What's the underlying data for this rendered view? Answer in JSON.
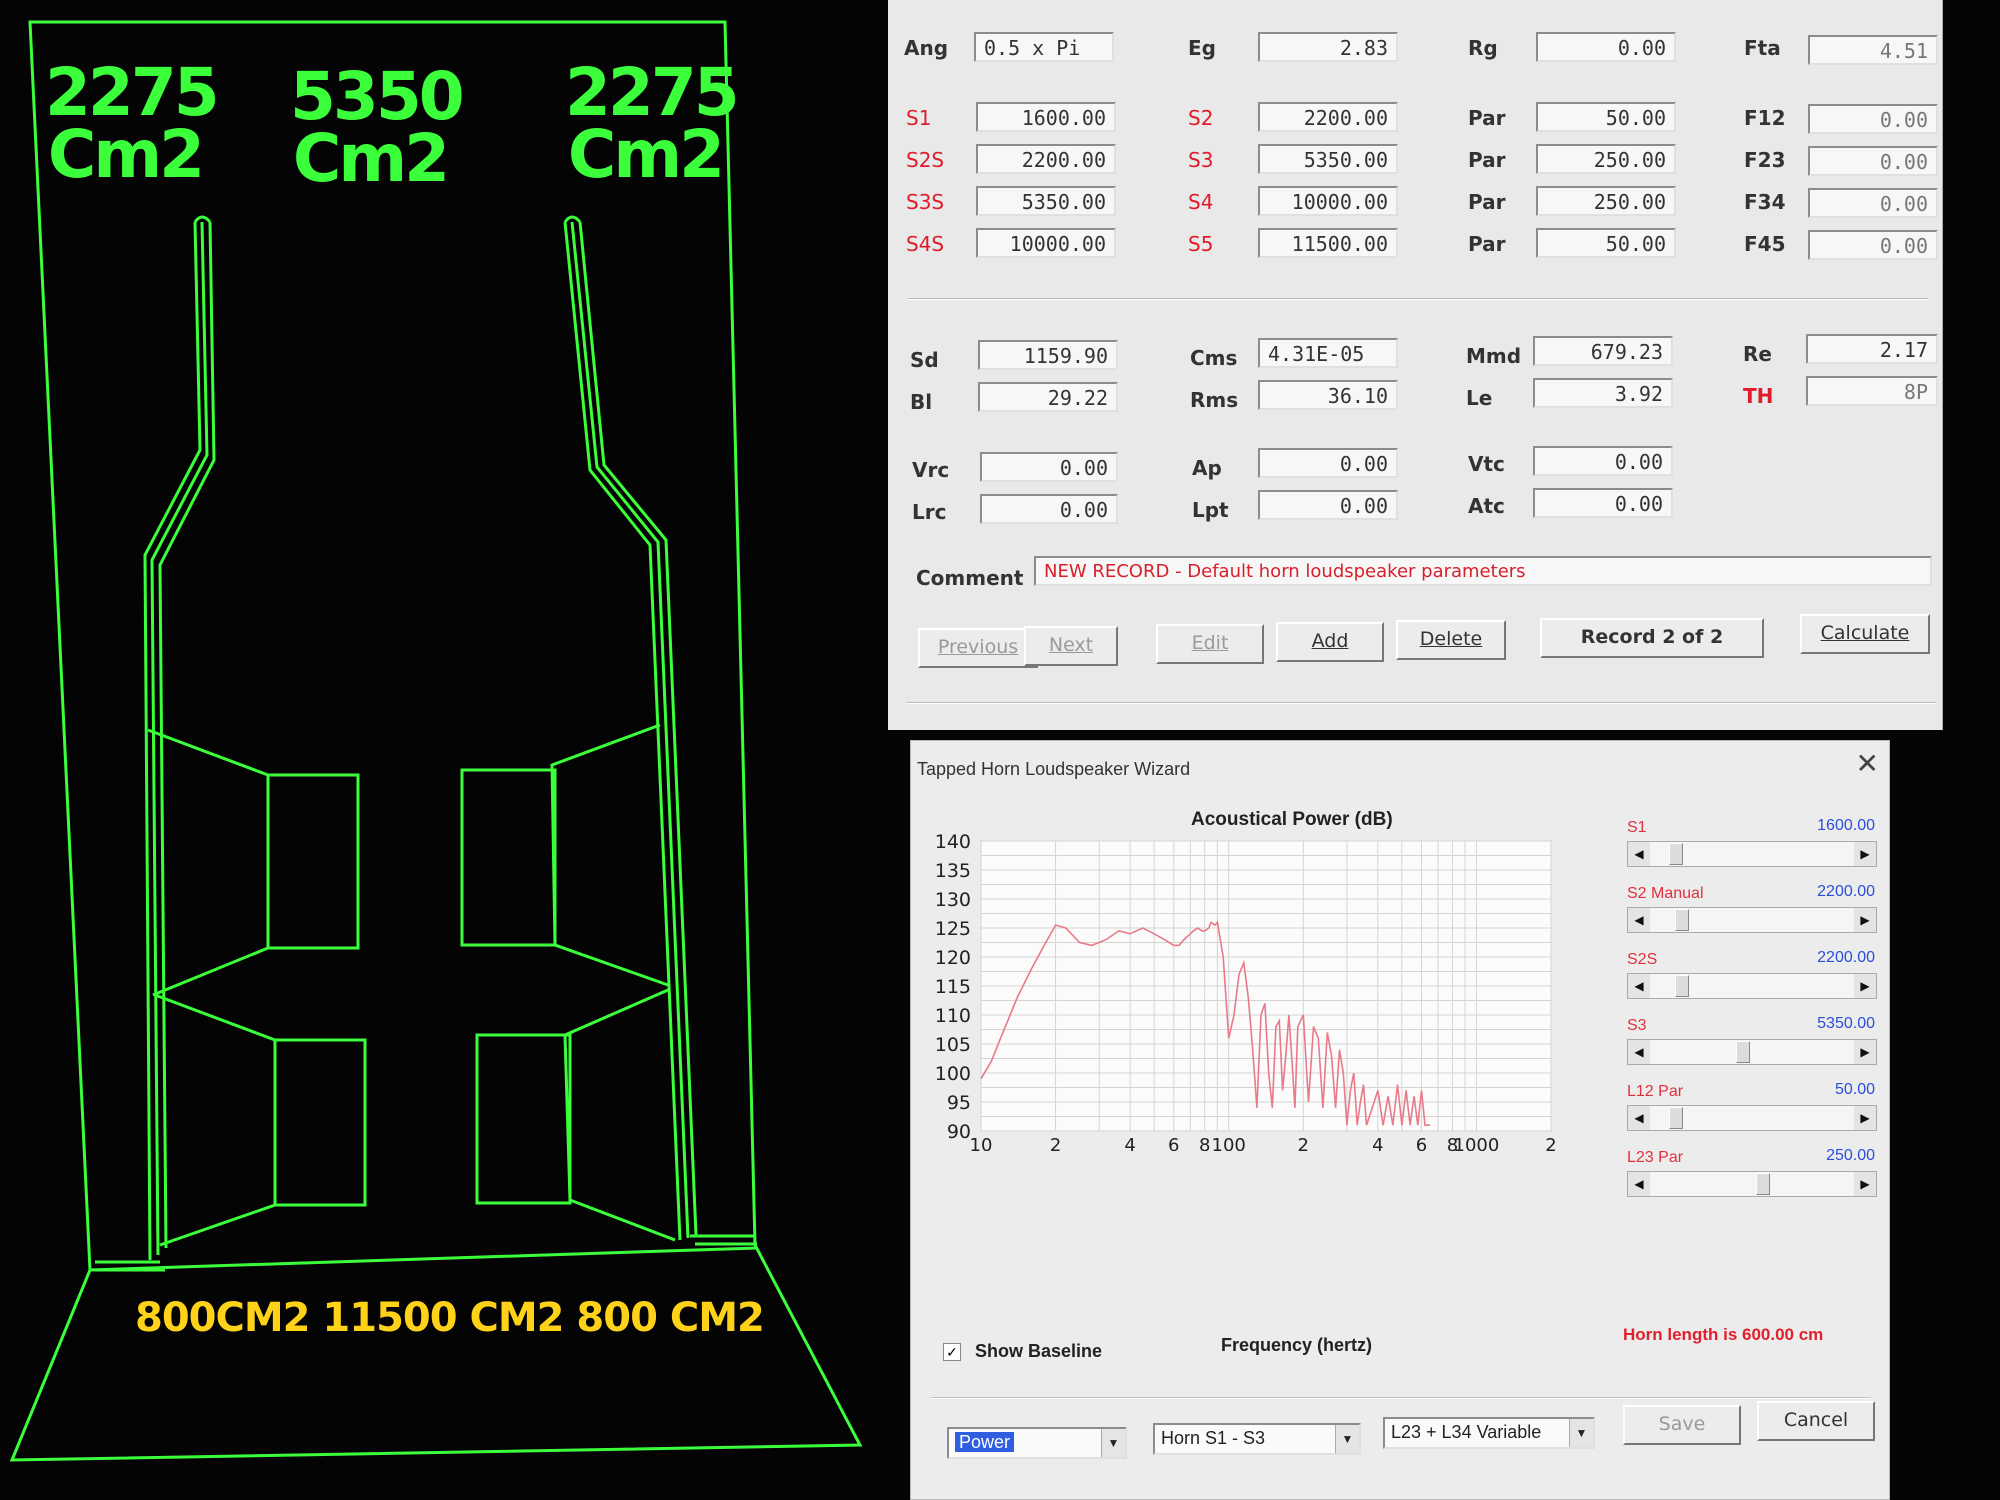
{
  "drawing": {
    "labels_top": [
      {
        "line1": "2275",
        "line2": "Cm2"
      },
      {
        "line1": "5350",
        "line2": "Cm2"
      },
      {
        "line1": "2275",
        "line2": "Cm2"
      }
    ],
    "bottom_label": "800CM2 11500 CM2 800 CM2",
    "line_color": "#3bff3b",
    "text_color_bottom": "#ffd21a"
  },
  "params": {
    "row_top": [
      {
        "label": "Ang",
        "value": "0.5 x Pi"
      },
      {
        "label": "Eg",
        "value": "2.83"
      },
      {
        "label": "Rg",
        "value": "0.00"
      },
      {
        "label": "Fta",
        "value": "4.51"
      }
    ],
    "section_rows": [
      {
        "s": "S1",
        "sv": "1600.00",
        "s2": "S2",
        "s2v": "2200.00",
        "par": "Par",
        "parv": "50.00",
        "f": "F12",
        "fv": "0.00"
      },
      {
        "s": "S2S",
        "sv": "2200.00",
        "s2": "S3",
        "s2v": "5350.00",
        "par": "Par",
        "parv": "250.00",
        "f": "F23",
        "fv": "0.00"
      },
      {
        "s": "S3S",
        "sv": "5350.00",
        "s2": "S4",
        "s2v": "10000.00",
        "par": "Par",
        "parv": "250.00",
        "f": "F34",
        "fv": "0.00"
      },
      {
        "s": "S4S",
        "sv": "10000.00",
        "s2": "S5",
        "s2v": "11500.00",
        "par": "Par",
        "parv": "50.00",
        "f": "F45",
        "fv": "0.00"
      }
    ],
    "driver_rows": [
      {
        "a": "Sd",
        "av": "1159.90",
        "b": "Cms",
        "bv": "4.31E-05",
        "c": "Mmd",
        "cv": "679.23",
        "d": "Re",
        "dv": "2.17"
      },
      {
        "a": "Bl",
        "av": "29.22",
        "b": "Rms",
        "bv": "36.10",
        "c": "Le",
        "cv": "3.92",
        "d": "TH",
        "dv": "8P"
      }
    ],
    "volume_rows": [
      {
        "a": "Vrc",
        "av": "0.00",
        "b": "Ap",
        "bv": "0.00",
        "c": "Vtc",
        "cv": "0.00"
      },
      {
        "a": "Lrc",
        "av": "0.00",
        "b": "Lpt",
        "bv": "0.00",
        "c": "Atc",
        "cv": "0.00"
      }
    ],
    "comment_label": "Comment",
    "comment_value": "NEW RECORD - Default horn loudspeaker parameters",
    "buttons": {
      "previous": "Previous",
      "next": "Next",
      "edit": "Edit",
      "add": "Add",
      "delete": "Delete",
      "record": "Record 2 of 2",
      "calculate": "Calculate"
    }
  },
  "wizard": {
    "title": "Tapped Horn Loudspeaker Wizard",
    "close": "✕",
    "chart_title": "Acoustical Power (dB)",
    "x_axis_label": "Frequency (hertz)",
    "x_tick_labels": [
      "10",
      "2",
      "4",
      "6",
      "8",
      "100",
      "2",
      "4",
      "6",
      "8",
      "1000",
      "2"
    ],
    "y_tick_labels": [
      "140",
      "135",
      "130",
      "125",
      "120",
      "115",
      "110",
      "105",
      "100",
      "95",
      "90"
    ],
    "show_baseline": {
      "checked": true,
      "label": "Show Baseline"
    },
    "horn_length": "Horn length is 600.00 cm",
    "sliders": [
      {
        "label": "S1",
        "value": "1600.00",
        "pos": 0.1
      },
      {
        "label": "S2 Manual",
        "value": "2200.00",
        "pos": 0.13
      },
      {
        "label": "S2S",
        "value": "2200.00",
        "pos": 0.13
      },
      {
        "label": "S3",
        "value": "5350.00",
        "pos": 0.45
      },
      {
        "label": "L12 Par",
        "value": "50.00",
        "pos": 0.1
      },
      {
        "label": "L23 Par",
        "value": "250.00",
        "pos": 0.55
      }
    ],
    "combos": {
      "mode": "Power",
      "horn": "Horn S1 - S3",
      "variable": "L23 + L34 Variable"
    },
    "buttons": {
      "save": "Save",
      "cancel": "Cancel"
    },
    "chart_colors": {
      "curve": "#e87a8a",
      "grid": "#d4d4d4"
    }
  },
  "chart_data": {
    "type": "line",
    "title": "Acoustical Power (dB)",
    "xlabel": "Frequency (hertz)",
    "ylabel": "",
    "xscale": "log",
    "xlim": [
      10,
      2000
    ],
    "ylim": [
      90,
      140
    ],
    "series": [
      {
        "x": [
          10,
          11,
          12,
          14,
          16,
          18,
          20,
          22,
          25,
          28,
          32,
          36,
          40,
          45,
          50,
          55,
          60,
          63,
          66,
          70,
          72,
          75,
          78,
          80,
          83,
          85,
          88,
          90,
          95,
          100,
          105,
          110,
          115,
          120,
          125,
          130,
          135,
          140,
          145,
          150,
          155,
          160,
          165,
          170,
          175,
          180,
          185,
          190,
          200,
          210,
          220,
          230,
          240,
          250,
          260,
          270,
          280,
          290,
          300,
          310,
          320,
          330,
          340,
          350,
          360,
          380,
          400,
          420,
          440,
          460,
          480,
          500,
          520,
          540,
          560,
          580,
          600,
          620,
          650
        ],
        "y": [
          99,
          102,
          106,
          113,
          118,
          122,
          125.5,
          125,
          122.5,
          122,
          123,
          124.5,
          124,
          125,
          124,
          123,
          122,
          122,
          123,
          124,
          124.5,
          125,
          124.5,
          124.5,
          125,
          126,
          125.5,
          126,
          120,
          106,
          110,
          117,
          119,
          113,
          104,
          94,
          110,
          112,
          100,
          94,
          108,
          109,
          97,
          103,
          110,
          102,
          94,
          108,
          110,
          95,
          108,
          106,
          94,
          107,
          103,
          94,
          104,
          100,
          91,
          97,
          100,
          91,
          95,
          98,
          91,
          94,
          97,
          91,
          96,
          91,
          98,
          91,
          97,
          91,
          96,
          91,
          97,
          91,
          91
        ]
      }
    ]
  }
}
